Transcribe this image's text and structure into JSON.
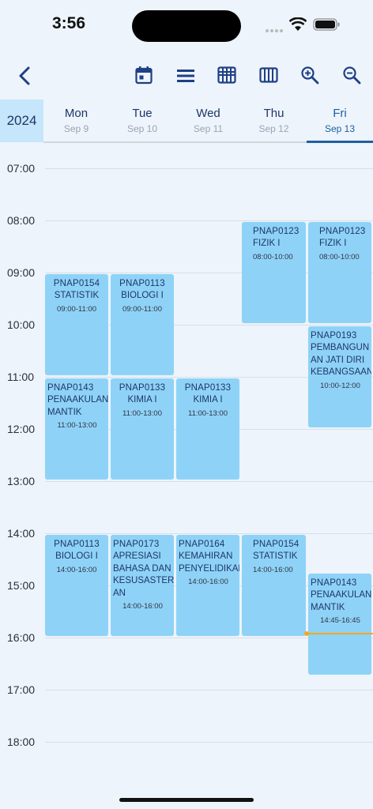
{
  "status_bar": {
    "time": "3:56"
  },
  "toolbar": {
    "back_icon": "chevron-left-icon",
    "icons": [
      "calendar-today-icon",
      "list-view-icon",
      "grid-view-icon",
      "week-columns-icon",
      "zoom-in-icon",
      "zoom-out-icon"
    ]
  },
  "header": {
    "year": "2024",
    "days": [
      {
        "name": "Mon",
        "date": "Sep 9"
      },
      {
        "name": "Tue",
        "date": "Sep 10"
      },
      {
        "name": "Wed",
        "date": "Sep 11"
      },
      {
        "name": "Thu",
        "date": "Sep 12"
      },
      {
        "name": "Fri",
        "date": "Sep 13"
      }
    ],
    "selected_day": "Fri"
  },
  "hours": [
    "07:00",
    "08:00",
    "09:00",
    "10:00",
    "11:00",
    "12:00",
    "13:00",
    "14:00",
    "15:00",
    "16:00",
    "17:00",
    "18:00"
  ],
  "events": [
    {
      "code": "PNAP0154",
      "name": "STATISTIK",
      "time": "09:00-11:00"
    },
    {
      "code": "PNAP0143",
      "name": "PENAAKULAN\nMANTIK",
      "time": "11:00-13:00"
    },
    {
      "code": "PNAP0113",
      "name": "BIOLOGI I",
      "time": "14:00-16:00"
    },
    {
      "code": "PNAP0113",
      "name": "BIOLOGI I",
      "time": "09:00-11:00"
    },
    {
      "code": "PNAP0133",
      "name": "KIMIA I",
      "time": "11:00-13:00"
    },
    {
      "code": "PNAP0173",
      "name": "APRESIASI\nBAHASA DAN\nKESUSASTERA\nAN",
      "time": "14:00-16:00"
    },
    {
      "code": "PNAP0133",
      "name": "KIMIA I",
      "time": "11:00-13:00"
    },
    {
      "code": "PNAP0164",
      "name": "KEMAHIRAN\nPENYELIDIKAN",
      "time": "14:00-16:00"
    },
    {
      "code": "PNAP0123",
      "name": "FIZIK I",
      "time": "08:00-10:00"
    },
    {
      "code": "PNAP0154",
      "name": "STATISTIK",
      "time": "14:00-16:00"
    },
    {
      "code": "PNAP0123",
      "name": "FIZIK I",
      "time": "08:00-10:00"
    },
    {
      "code": "PNAP0193",
      "name": "PEMBANGUN\nAN JATI DIRI\nKEBANGSAAN",
      "time": "10:00-12:00"
    },
    {
      "code": "PNAP0143",
      "name": "PENAAKULAN\nMANTIK",
      "time": "14:45-16:45"
    }
  ],
  "colors": {
    "accent": "#1f5fa0",
    "event": "#8ed3f7",
    "now_line": "#f5a623",
    "year_bg": "#c5e6fb"
  }
}
